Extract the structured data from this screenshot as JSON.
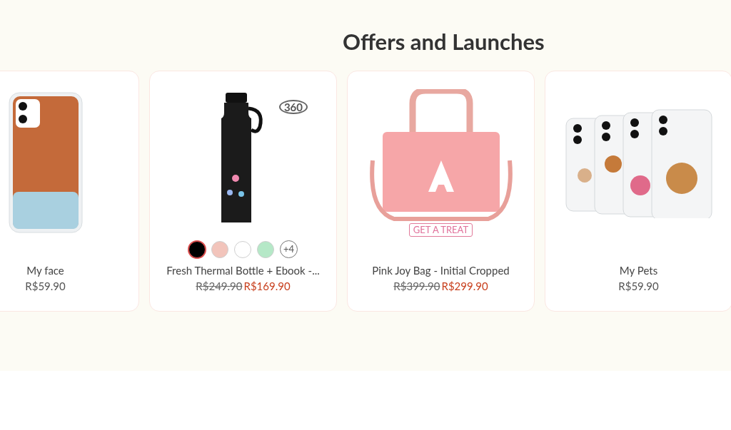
{
  "section": {
    "title": "Offers and Launches"
  },
  "products": [
    {
      "kind": "phone-case",
      "name": "My face",
      "price": "R$59.90"
    },
    {
      "kind": "bottle",
      "view_badge": "360",
      "swatches": [
        {
          "color": "#000000",
          "selected": true
        },
        {
          "color": "#f2c4bb",
          "selected": false
        },
        {
          "color": "#ffffff",
          "selected": false
        },
        {
          "color": "#b5e8c7",
          "selected": false
        }
      ],
      "more_swatches": "+4",
      "name": "Fresh Thermal Bottle + Ebook -...",
      "old_price": "R$249.90",
      "price": "R$169.90"
    },
    {
      "kind": "bag",
      "badge": "GET A TREAT",
      "name": "Pink Joy Bag - Initial Cropped",
      "old_price": "R$399.90",
      "price": "R$299.90"
    },
    {
      "kind": "phone-cases",
      "name": "My Pets",
      "price": "R$59.90"
    }
  ]
}
